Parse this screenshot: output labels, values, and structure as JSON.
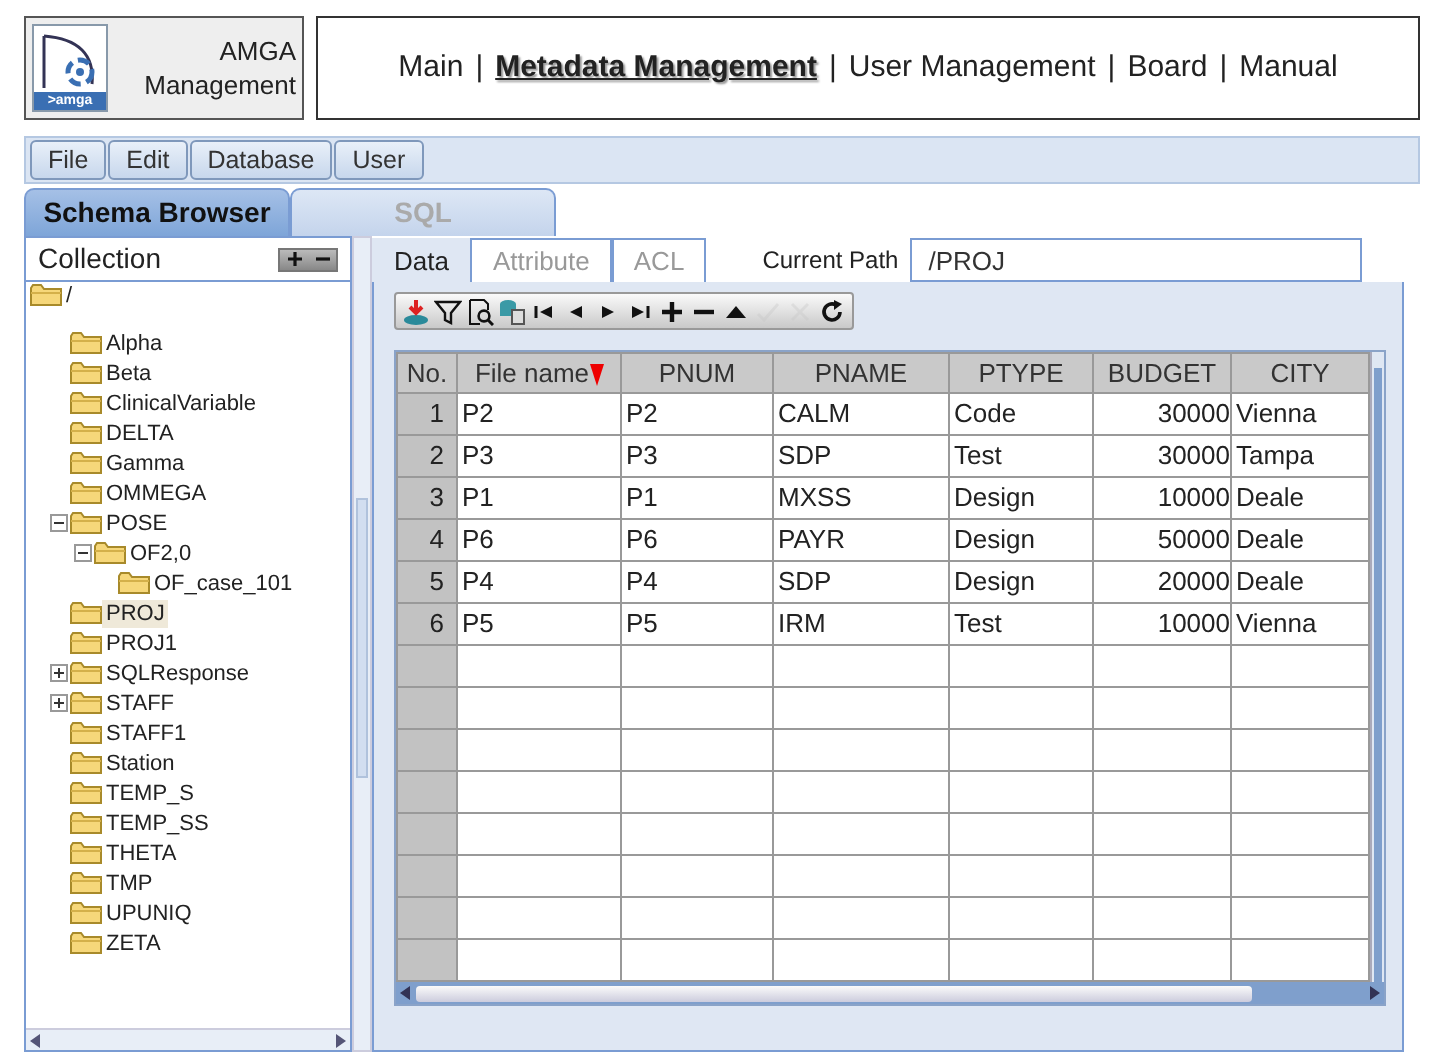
{
  "logo": {
    "caption": ">amga",
    "title_lines": [
      "AMGA",
      "Management"
    ]
  },
  "nav": [
    {
      "kind": "link",
      "label": "Main",
      "selected": false
    },
    {
      "kind": "separator",
      "label": "|"
    },
    {
      "kind": "link",
      "label": "Metadata Management",
      "selected": true
    },
    {
      "kind": "separator",
      "label": "|"
    },
    {
      "kind": "link",
      "label": "User Management",
      "selected": false
    },
    {
      "kind": "separator",
      "label": "|"
    },
    {
      "kind": "link",
      "label": "Board",
      "selected": false
    },
    {
      "kind": "separator",
      "label": "|"
    },
    {
      "kind": "link",
      "label": "Manual",
      "selected": false
    }
  ],
  "menu": [
    "File",
    "Edit",
    "Database",
    "User"
  ],
  "main_tabs": [
    {
      "label": "Schema Browser",
      "selected": true
    },
    {
      "label": "SQL",
      "selected": false
    }
  ],
  "collection": {
    "title": "Collection",
    "tree": [
      {
        "label": "/",
        "selected": false,
        "children": [
          {
            "label": "Alpha",
            "selected": false
          },
          {
            "label": "Beta",
            "selected": false
          },
          {
            "label": "ClinicalVariable",
            "selected": false
          },
          {
            "label": "DELTA",
            "selected": false
          },
          {
            "label": "Gamma",
            "selected": false
          },
          {
            "label": "OMMEGA",
            "selected": false
          },
          {
            "label": "POSE",
            "selected": false,
            "expanded": true,
            "children": [
              {
                "label": "OF2,0",
                "selected": false,
                "expanded": true,
                "children": [
                  {
                    "label": "OF_case_101",
                    "selected": false
                  }
                ]
              }
            ]
          },
          {
            "label": "PROJ",
            "selected": true
          },
          {
            "label": "PROJ1",
            "selected": false
          },
          {
            "label": "SQLResponse",
            "selected": false,
            "expanded": false
          },
          {
            "label": "STAFF",
            "selected": false,
            "expanded": false
          },
          {
            "label": "STAFF1",
            "selected": false
          },
          {
            "label": "Station",
            "selected": false
          },
          {
            "label": "TEMP_S",
            "selected": false
          },
          {
            "label": "TEMP_SS",
            "selected": false
          },
          {
            "label": "THETA",
            "selected": false
          },
          {
            "label": "TMP",
            "selected": false
          },
          {
            "label": "UPUNIQ",
            "selected": false
          },
          {
            "label": "ZETA",
            "selected": false
          }
        ]
      }
    ]
  },
  "sub_tabs": [
    {
      "label": "Data",
      "selected": true
    },
    {
      "label": "Attribute",
      "selected": false
    },
    {
      "label": "ACL",
      "selected": false
    }
  ],
  "current_path": {
    "label": "Current Path",
    "value": "/PROJ"
  },
  "toolbar": [
    {
      "kind": "export",
      "disabled": false
    },
    {
      "kind": "filter",
      "disabled": false
    },
    {
      "kind": "preview",
      "disabled": false
    },
    {
      "kind": "database",
      "disabled": false
    },
    {
      "kind": "first",
      "disabled": false
    },
    {
      "kind": "prev",
      "disabled": false
    },
    {
      "kind": "next",
      "disabled": false
    },
    {
      "kind": "last",
      "disabled": false
    },
    {
      "kind": "add",
      "disabled": false
    },
    {
      "kind": "remove",
      "disabled": false
    },
    {
      "kind": "up",
      "disabled": false
    },
    {
      "kind": "confirm",
      "disabled": true
    },
    {
      "kind": "cancel",
      "disabled": true
    },
    {
      "kind": "refresh",
      "disabled": false
    }
  ],
  "table": {
    "columns": [
      {
        "label": "No.",
        "sorted": false
      },
      {
        "label": "File name",
        "sorted": true
      },
      {
        "label": "PNUM",
        "sorted": false
      },
      {
        "label": "PNAME",
        "sorted": false
      },
      {
        "label": "PTYPE",
        "sorted": false
      },
      {
        "label": "BUDGET",
        "sorted": false
      },
      {
        "label": "CITY",
        "sorted": false
      }
    ],
    "rows": [
      [
        "1",
        "P2",
        "P2",
        "CALM",
        "Code",
        "30000",
        "Vienna"
      ],
      [
        "2",
        "P3",
        "P3",
        "SDP",
        "Test",
        "30000",
        "Tampa"
      ],
      [
        "3",
        "P1",
        "P1",
        "MXSS",
        "Design",
        "10000",
        "Deale"
      ],
      [
        "4",
        "P6",
        "P6",
        "PAYR",
        "Design",
        "50000",
        "Deale"
      ],
      [
        "5",
        "P4",
        "P4",
        "SDP",
        "Design",
        "20000",
        "Deale"
      ],
      [
        "6",
        "P5",
        "P5",
        "IRM",
        "Test",
        "10000",
        "Vienna"
      ]
    ]
  }
}
